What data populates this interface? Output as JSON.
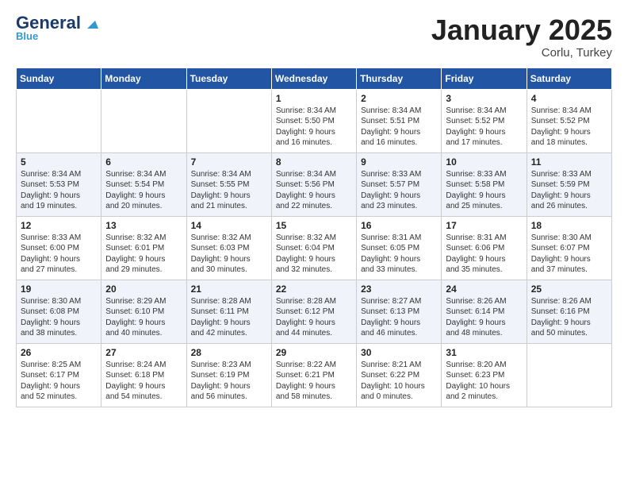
{
  "header": {
    "logo_general": "General",
    "logo_blue": "Blue",
    "month_title": "January 2025",
    "location": "Corlu, Turkey"
  },
  "days_of_week": [
    "Sunday",
    "Monday",
    "Tuesday",
    "Wednesday",
    "Thursday",
    "Friday",
    "Saturday"
  ],
  "weeks": [
    [
      {
        "day": "",
        "info": ""
      },
      {
        "day": "",
        "info": ""
      },
      {
        "day": "",
        "info": ""
      },
      {
        "day": "1",
        "info": "Sunrise: 8:34 AM\nSunset: 5:50 PM\nDaylight: 9 hours\nand 16 minutes."
      },
      {
        "day": "2",
        "info": "Sunrise: 8:34 AM\nSunset: 5:51 PM\nDaylight: 9 hours\nand 16 minutes."
      },
      {
        "day": "3",
        "info": "Sunrise: 8:34 AM\nSunset: 5:52 PM\nDaylight: 9 hours\nand 17 minutes."
      },
      {
        "day": "4",
        "info": "Sunrise: 8:34 AM\nSunset: 5:52 PM\nDaylight: 9 hours\nand 18 minutes."
      }
    ],
    [
      {
        "day": "5",
        "info": "Sunrise: 8:34 AM\nSunset: 5:53 PM\nDaylight: 9 hours\nand 19 minutes."
      },
      {
        "day": "6",
        "info": "Sunrise: 8:34 AM\nSunset: 5:54 PM\nDaylight: 9 hours\nand 20 minutes."
      },
      {
        "day": "7",
        "info": "Sunrise: 8:34 AM\nSunset: 5:55 PM\nDaylight: 9 hours\nand 21 minutes."
      },
      {
        "day": "8",
        "info": "Sunrise: 8:34 AM\nSunset: 5:56 PM\nDaylight: 9 hours\nand 22 minutes."
      },
      {
        "day": "9",
        "info": "Sunrise: 8:33 AM\nSunset: 5:57 PM\nDaylight: 9 hours\nand 23 minutes."
      },
      {
        "day": "10",
        "info": "Sunrise: 8:33 AM\nSunset: 5:58 PM\nDaylight: 9 hours\nand 25 minutes."
      },
      {
        "day": "11",
        "info": "Sunrise: 8:33 AM\nSunset: 5:59 PM\nDaylight: 9 hours\nand 26 minutes."
      }
    ],
    [
      {
        "day": "12",
        "info": "Sunrise: 8:33 AM\nSunset: 6:00 PM\nDaylight: 9 hours\nand 27 minutes."
      },
      {
        "day": "13",
        "info": "Sunrise: 8:32 AM\nSunset: 6:01 PM\nDaylight: 9 hours\nand 29 minutes."
      },
      {
        "day": "14",
        "info": "Sunrise: 8:32 AM\nSunset: 6:03 PM\nDaylight: 9 hours\nand 30 minutes."
      },
      {
        "day": "15",
        "info": "Sunrise: 8:32 AM\nSunset: 6:04 PM\nDaylight: 9 hours\nand 32 minutes."
      },
      {
        "day": "16",
        "info": "Sunrise: 8:31 AM\nSunset: 6:05 PM\nDaylight: 9 hours\nand 33 minutes."
      },
      {
        "day": "17",
        "info": "Sunrise: 8:31 AM\nSunset: 6:06 PM\nDaylight: 9 hours\nand 35 minutes."
      },
      {
        "day": "18",
        "info": "Sunrise: 8:30 AM\nSunset: 6:07 PM\nDaylight: 9 hours\nand 37 minutes."
      }
    ],
    [
      {
        "day": "19",
        "info": "Sunrise: 8:30 AM\nSunset: 6:08 PM\nDaylight: 9 hours\nand 38 minutes."
      },
      {
        "day": "20",
        "info": "Sunrise: 8:29 AM\nSunset: 6:10 PM\nDaylight: 9 hours\nand 40 minutes."
      },
      {
        "day": "21",
        "info": "Sunrise: 8:28 AM\nSunset: 6:11 PM\nDaylight: 9 hours\nand 42 minutes."
      },
      {
        "day": "22",
        "info": "Sunrise: 8:28 AM\nSunset: 6:12 PM\nDaylight: 9 hours\nand 44 minutes."
      },
      {
        "day": "23",
        "info": "Sunrise: 8:27 AM\nSunset: 6:13 PM\nDaylight: 9 hours\nand 46 minutes."
      },
      {
        "day": "24",
        "info": "Sunrise: 8:26 AM\nSunset: 6:14 PM\nDaylight: 9 hours\nand 48 minutes."
      },
      {
        "day": "25",
        "info": "Sunrise: 8:26 AM\nSunset: 6:16 PM\nDaylight: 9 hours\nand 50 minutes."
      }
    ],
    [
      {
        "day": "26",
        "info": "Sunrise: 8:25 AM\nSunset: 6:17 PM\nDaylight: 9 hours\nand 52 minutes."
      },
      {
        "day": "27",
        "info": "Sunrise: 8:24 AM\nSunset: 6:18 PM\nDaylight: 9 hours\nand 54 minutes."
      },
      {
        "day": "28",
        "info": "Sunrise: 8:23 AM\nSunset: 6:19 PM\nDaylight: 9 hours\nand 56 minutes."
      },
      {
        "day": "29",
        "info": "Sunrise: 8:22 AM\nSunset: 6:21 PM\nDaylight: 9 hours\nand 58 minutes."
      },
      {
        "day": "30",
        "info": "Sunrise: 8:21 AM\nSunset: 6:22 PM\nDaylight: 10 hours\nand 0 minutes."
      },
      {
        "day": "31",
        "info": "Sunrise: 8:20 AM\nSunset: 6:23 PM\nDaylight: 10 hours\nand 2 minutes."
      },
      {
        "day": "",
        "info": ""
      }
    ]
  ]
}
